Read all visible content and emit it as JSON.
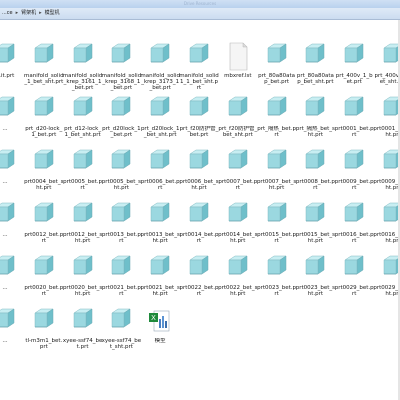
{
  "window": {
    "title": "Drive Resources"
  },
  "breadcrumb": {
    "items": [
      "...ce",
      "臂架机",
      "模型机"
    ],
    "separator": "▸"
  },
  "colors": {
    "cube_face": "#9bd8e0",
    "cube_top": "#c8eef2",
    "cube_side": "#6fbfca"
  },
  "files": [
    {
      "label": "...it.prt",
      "type": "cube"
    },
    {
      "label": "manifold_solid_1_bet_sht.prt",
      "type": "cube"
    },
    {
      "label": "manifold_solid_krep_3161_1_bet.prt",
      "type": "cube"
    },
    {
      "label": "manifold_solid_krep_3168_1_bet.prt",
      "type": "cube"
    },
    {
      "label": "manifold_solid_krep_3173_1_bet.prt",
      "type": "cube"
    },
    {
      "label": "manifold_solid1_1_bet_sht.prt",
      "type": "cube"
    },
    {
      "label": "mbxref.lst",
      "type": "blank"
    },
    {
      "label": "prt_80a80atap_bet.prt",
      "type": "cube"
    },
    {
      "label": "prt_80a80atap_bet_sht.prt",
      "type": "cube"
    },
    {
      "label": "prt_400v_1_bet.prt",
      "type": "cube"
    },
    {
      "label": "prt_400v_1_bet_sht.prt",
      "type": "cube"
    },
    {
      "label": "...",
      "type": "cube"
    },
    {
      "label": "prt_d20-lock_1_bet.prt",
      "type": "cube"
    },
    {
      "label": "prt_d12-lock_1_bet_sht.prt",
      "type": "cube"
    },
    {
      "label": "prt_d20lock_1_bet.prt",
      "type": "cube"
    },
    {
      "label": "prt_d20lock_1_bet_sht.prt",
      "type": "cube"
    },
    {
      "label": "prt_f20防护管_bet.prt",
      "type": "cube"
    },
    {
      "label": "prt_f20防护管_bet_sht.prt",
      "type": "cube"
    },
    {
      "label": "prt_隔热_bet.prt",
      "type": "cube"
    },
    {
      "label": "prt_隔热_bet_sht.prt",
      "type": "cube"
    },
    {
      "label": "prt0001_bet.prt",
      "type": "cube"
    },
    {
      "label": "prt0001_bet_sht.prt",
      "type": "cube"
    },
    {
      "label": "...",
      "type": "cube"
    },
    {
      "label": "prt0004_bet_sht.prt",
      "type": "cube"
    },
    {
      "label": "prt0005_bet.prt",
      "type": "cube"
    },
    {
      "label": "prt0005_bet_sht.prt",
      "type": "cube"
    },
    {
      "label": "prt0006_bet.prt",
      "type": "cube"
    },
    {
      "label": "prt0006_bet_sht.prt",
      "type": "cube"
    },
    {
      "label": "prt0007_bet.prt",
      "type": "cube"
    },
    {
      "label": "prt0007_bet_sht.prt",
      "type": "cube"
    },
    {
      "label": "prt0008_bet.prt",
      "type": "cube"
    },
    {
      "label": "prt0009_bet.prt",
      "type": "cube"
    },
    {
      "label": "prt0009_bet_sht.prt",
      "type": "cube"
    },
    {
      "label": "...",
      "type": "cube"
    },
    {
      "label": "prt0012_bet.prt",
      "type": "cube"
    },
    {
      "label": "prt0012_bet_sht.prt",
      "type": "cube"
    },
    {
      "label": "prt0013_bet.prt",
      "type": "cube"
    },
    {
      "label": "prt0013_bet_sht.prt",
      "type": "cube"
    },
    {
      "label": "prt0014_bet.prt",
      "type": "cube"
    },
    {
      "label": "prt0014_bet_sht.prt",
      "type": "cube"
    },
    {
      "label": "prt0015_bet.prt",
      "type": "cube"
    },
    {
      "label": "prt0015_bet_sht.prt",
      "type": "cube"
    },
    {
      "label": "prt0016_bet.prt",
      "type": "cube"
    },
    {
      "label": "prt0016_bet_sht.prt",
      "type": "cube"
    },
    {
      "label": "...",
      "type": "cube"
    },
    {
      "label": "prt0020_bet.prt",
      "type": "cube"
    },
    {
      "label": "prt0020_bet_sht.prt",
      "type": "cube"
    },
    {
      "label": "prt0021_bet.prt",
      "type": "cube"
    },
    {
      "label": "prt0021_bet_sht.prt",
      "type": "cube"
    },
    {
      "label": "prt0022_bet.prt",
      "type": "cube"
    },
    {
      "label": "prt0022_bet_sht.prt",
      "type": "cube"
    },
    {
      "label": "prt0023_bet.prt",
      "type": "cube"
    },
    {
      "label": "prt0023_bet_sht.prt",
      "type": "cube"
    },
    {
      "label": "prt0029_bet.prt",
      "type": "cube"
    },
    {
      "label": "prt0029_bet_sht.prt",
      "type": "cube"
    },
    {
      "label": "...",
      "type": "cube"
    },
    {
      "label": "tl-m3m1_bet.prt",
      "type": "cube"
    },
    {
      "label": "xyee-ssf74_bet.prt",
      "type": "cube"
    },
    {
      "label": "xyee-ssf74_bet_sht.prt",
      "type": "cube"
    },
    {
      "label": "模型",
      "type": "excel"
    }
  ]
}
